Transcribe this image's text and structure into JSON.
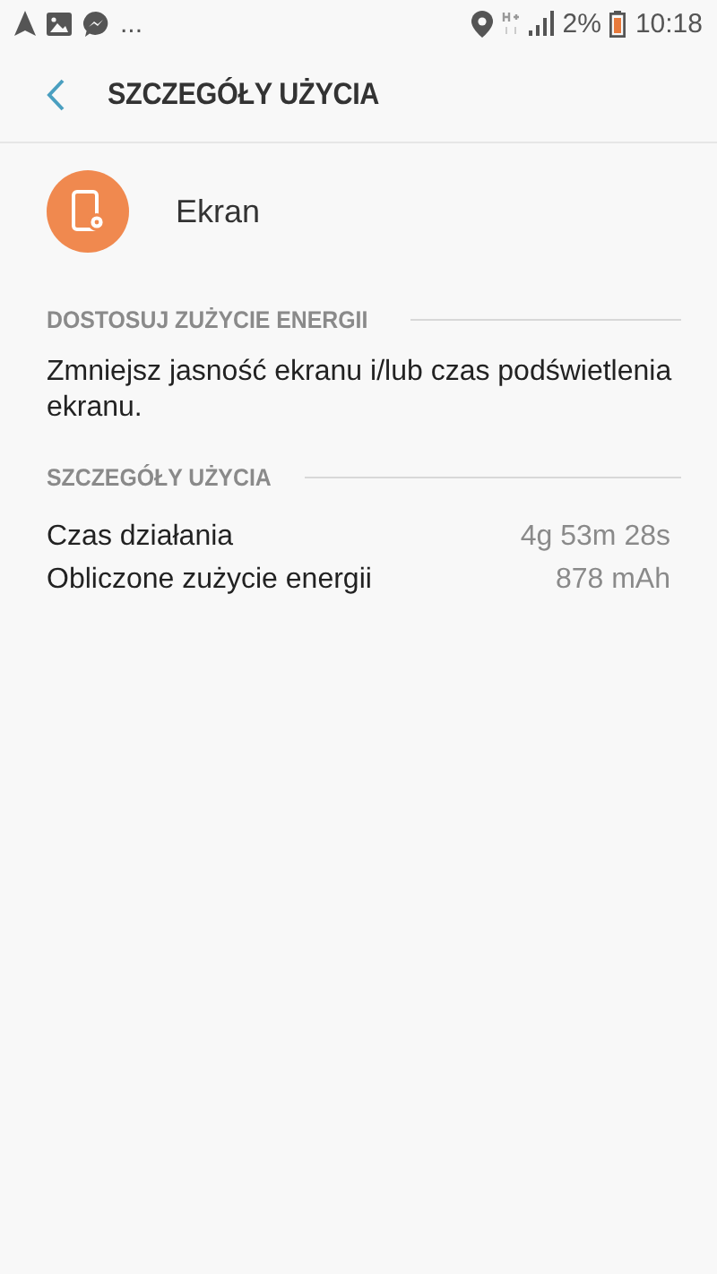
{
  "status_bar": {
    "notifications_more": "...",
    "battery": "2%",
    "time": "10:18"
  },
  "header": {
    "title": "SZCZEGÓŁY UŻYCIA"
  },
  "app": {
    "name": "Ekran"
  },
  "sections": [
    {
      "title": "DOSTOSUJ ZUŻYCIE ENERGII",
      "kind": "text",
      "text": "Zmniejsz jasność ekranu i/lub czas podświetlenia ekranu."
    },
    {
      "title": "SZCZEGÓŁY UŻYCIA",
      "kind": "rows",
      "rows": [
        {
          "label": "Czas działania",
          "value": "4g 53m 28s"
        },
        {
          "label": "Obliczone zużycie energii",
          "value": "878 mAh"
        }
      ]
    }
  ]
}
